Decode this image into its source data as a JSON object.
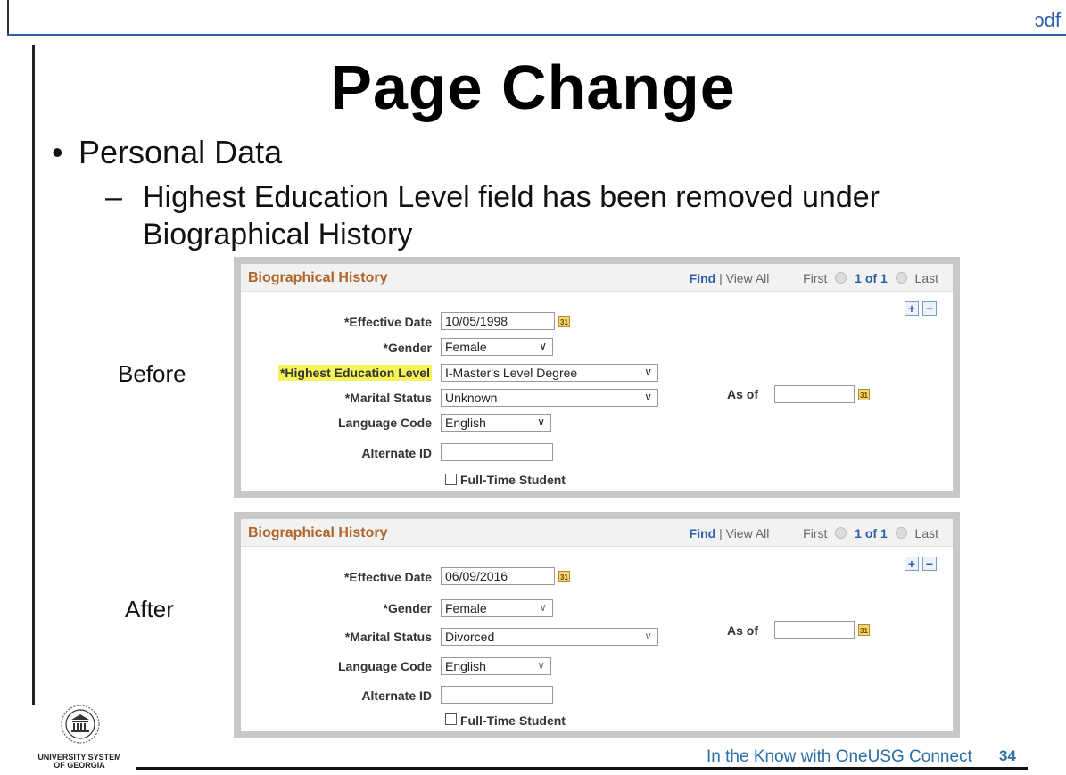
{
  "header": {
    "pdf_text": "ɔdf"
  },
  "slide": {
    "title": "Page Change",
    "bullet": "Personal Data",
    "sub_bullet_dash": "–",
    "sub_bullet": "Highest Education Level field has been removed under Biographical History",
    "label_before": "Before",
    "label_after": "After"
  },
  "before_panel": {
    "title": "Biographical History",
    "nav": {
      "find": "Find",
      "sep": "|",
      "view_all": "View All",
      "first": "First",
      "count": "1 of 1",
      "last": "Last"
    },
    "fields": {
      "effective_date_label": "*Effective Date",
      "effective_date_value": "10/05/1998",
      "gender_label": "*Gender",
      "gender_value": "Female",
      "education_label": "*Highest Education Level",
      "education_value": "I-Master's Level Degree",
      "marital_label": "*Marital Status",
      "marital_value": "Unknown",
      "language_label": "Language Code",
      "language_value": "English",
      "alternate_label": "Alternate ID",
      "alternate_value": "",
      "asof_label": "As of",
      "asof_value": "",
      "fulltime_label": "Full-Time Student"
    }
  },
  "after_panel": {
    "title": "Biographical History",
    "nav": {
      "find": "Find",
      "sep": "|",
      "view_all": "View All",
      "first": "First",
      "count": "1 of 1",
      "last": "Last"
    },
    "fields": {
      "effective_date_label": "*Effective Date",
      "effective_date_value": "06/09/2016",
      "gender_label": "*Gender",
      "gender_value": "Female",
      "marital_label": "*Marital Status",
      "marital_value": "Divorced",
      "language_label": "Language Code",
      "language_value": "English",
      "alternate_label": "Alternate ID",
      "alternate_value": "",
      "asof_label": "As of",
      "asof_value": "",
      "fulltime_label": "Full-Time Student"
    }
  },
  "icons": {
    "add": "+",
    "remove": "−",
    "calendar": "31",
    "chevron": "∨"
  },
  "footer": {
    "logo_text_line1": "UNIVERSITY SYSTEM",
    "logo_text_line2": "OF GEORGIA",
    "tagline": "In the Know with OneUSG Connect",
    "page_number": "34"
  },
  "colors": {
    "accent_blue": "#2b5fa8",
    "panel_title": "#b0652a",
    "highlight": "#f5f55a",
    "panel_border": "#c8c8c8"
  }
}
